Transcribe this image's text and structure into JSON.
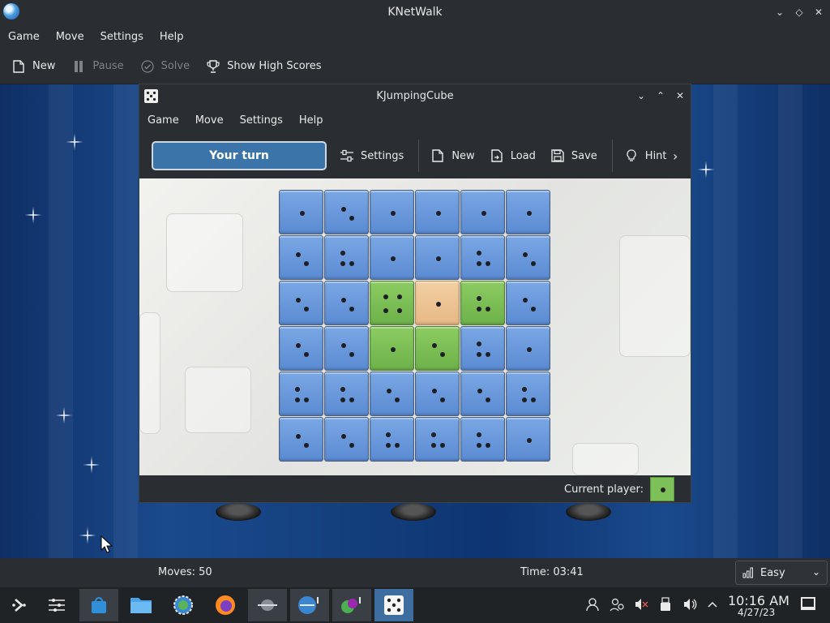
{
  "outer_window": {
    "title": "KNetWalk",
    "menu": [
      "Game",
      "Move",
      "Settings",
      "Help"
    ],
    "toolbar": {
      "new_label": "New",
      "pause_label": "Pause",
      "solve_label": "Solve",
      "highscores_label": "Show High Scores"
    },
    "status": {
      "moves": "Moves: 50",
      "time": "Time: 03:41",
      "difficulty": "Easy"
    }
  },
  "kj_window": {
    "title": "KJumpingCube",
    "menu": [
      "Game",
      "Move",
      "Settings",
      "Help"
    ],
    "toolbar": {
      "turn_label": "Your turn",
      "settings_label": "Settings",
      "new_label": "New",
      "load_label": "Load",
      "save_label": "Save",
      "hint_label": "Hint"
    },
    "status": {
      "current_player_label": "Current player:"
    },
    "board": {
      "rows": [
        [
          [
            "blue",
            1
          ],
          [
            "blue",
            2
          ],
          [
            "blue",
            1
          ],
          [
            "blue",
            1
          ],
          [
            "blue",
            1
          ],
          [
            "blue",
            1
          ]
        ],
        [
          [
            "blue",
            2
          ],
          [
            "blue",
            3
          ],
          [
            "blue",
            1
          ],
          [
            "blue",
            1
          ],
          [
            "blue",
            3
          ],
          [
            "blue",
            2
          ]
        ],
        [
          [
            "blue",
            2
          ],
          [
            "blue",
            2
          ],
          [
            "green",
            4
          ],
          [
            "tan",
            1
          ],
          [
            "green",
            3
          ],
          [
            "blue",
            2
          ]
        ],
        [
          [
            "blue",
            2
          ],
          [
            "blue",
            2
          ],
          [
            "green",
            1
          ],
          [
            "green",
            2
          ],
          [
            "blue",
            3
          ],
          [
            "blue",
            1
          ]
        ],
        [
          [
            "blue",
            3
          ],
          [
            "blue",
            3
          ],
          [
            "blue",
            2
          ],
          [
            "blue",
            2
          ],
          [
            "blue",
            2
          ],
          [
            "blue",
            3
          ]
        ],
        [
          [
            "blue",
            2
          ],
          [
            "blue",
            2
          ],
          [
            "blue",
            3
          ],
          [
            "blue",
            3
          ],
          [
            "blue",
            3
          ],
          [
            "blue",
            1
          ]
        ]
      ],
      "colors": {
        "player_one": "#5a8ad2",
        "player_two": "#7dc05a",
        "neutral": "#e7b884"
      }
    }
  },
  "taskbar": {
    "clock_time": "10:16 AM",
    "clock_date": "4/27/23"
  }
}
